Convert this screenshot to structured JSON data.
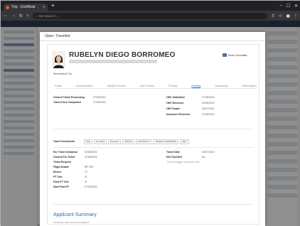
{
  "browser": {
    "tab_title": "Trip - Unofficial",
    "url": "○ Not secure | ..."
  },
  "modal": {
    "title": "Open: Travelled",
    "name": "RUBELYN DIEGO BORROMEO",
    "email_button": "Email Consultant",
    "recruitment_trip_label": "Recruitment Trip",
    "recruitment_trip_value": "",
    "tabs": [
      "Profile",
      "Documentation",
      "Medical Process",
      "Visa Process",
      "Flowing",
      "Pending",
      "Accounting",
      "Other Actions"
    ],
    "active_tab": "Pending",
    "left_fields": [
      {
        "k": "Cleared Travel Processing",
        "v": "27/05/2022"
      },
      {
        "k": "Travel Docs Completed",
        "v": "27/05/2022"
      }
    ],
    "right_fields": [
      {
        "k": "OEC Submitted",
        "v": "27/05/2022"
      },
      {
        "k": "OEC Received",
        "v": "31/05/2022"
      },
      {
        "k": "OEC Expire",
        "v": "30/07/2022"
      },
      {
        "k": "Insurance Received",
        "v": "27/05/2022"
      }
    ],
    "travel_docs_label": "Travel Documents",
    "travel_docs_chips": [
      "Visa",
      "Air Ticket",
      "Passport",
      "OPPCR",
      "CONTRACT",
      "TRAVEL INSURANCE",
      "OEC"
    ],
    "lower_left": [
      {
        "k": "For Ticket Clearance",
        "v": "02/06/2022"
      },
      {
        "k": "Cleared For Ticket",
        "v": "02/06/2022"
      },
      {
        "k": "Ticket Request",
        "v": ""
      },
      {
        "k": "Flight Details",
        "v": "BR 783"
      },
      {
        "k": "Resort",
        "v": "T1"
      },
      {
        "k": "PT Test",
        "v": "11"
      },
      {
        "k": "Final PT Test",
        "v": "11"
      },
      {
        "k": "Date Final PT",
        "v": "07/06/2022"
      }
    ],
    "lower_right": [
      {
        "k": "Travel Date",
        "v": "06/07/2022"
      },
      {
        "k": "Not Travelled",
        "v": "No"
      },
      {
        "k": "",
        "v": "This will trigger employer feed"
      }
    ],
    "summary_title": "Applicant Summary",
    "summary_sub": "01/06/2022 GRS DAO ATTACHMENT"
  }
}
